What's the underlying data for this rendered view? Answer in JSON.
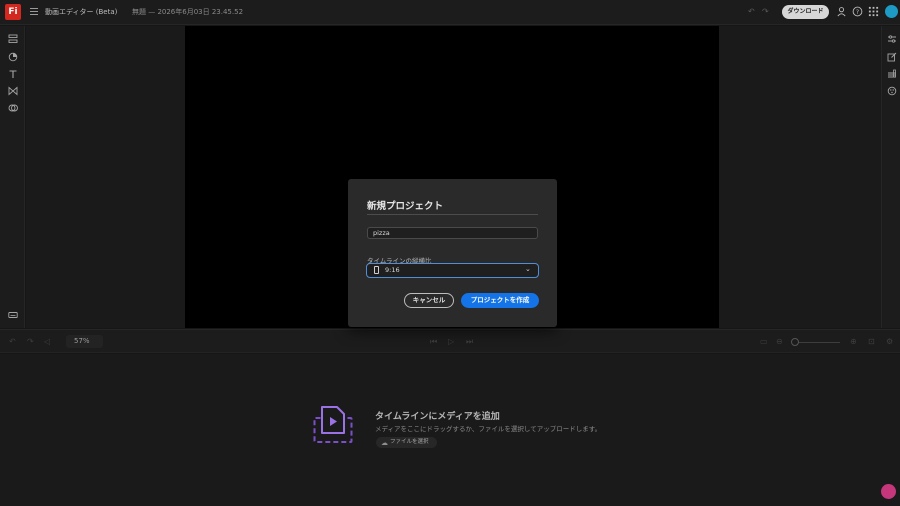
{
  "app": {
    "logo_text": "Fi",
    "title": "動画エディター (Beta)",
    "document_title": "無題 — 2026年6月03日 23.45.52",
    "download_label": "ダウンロード"
  },
  "left_tools": [
    "layers-icon",
    "shapes-icon",
    "text-icon",
    "transitions-icon",
    "media-icon"
  ],
  "right_tools": [
    "adjust-icon",
    "edit-icon",
    "audio-icon",
    "color-icon"
  ],
  "timeline": {
    "zoom": "57%",
    "empty_title": "タイムラインにメディアを追加",
    "empty_subtitle": "メディアをここにドラッグするか、ファイルを選択してアップロードします。",
    "file_button": "ファイルを選択"
  },
  "dialog": {
    "title": "新規プロジェクト",
    "project_name": "pizza",
    "ratio_label": "タイムラインの縦横比",
    "ratio_value": "9:16",
    "cancel_label": "キャンセル",
    "create_label": "プロジェクトを作成"
  },
  "colors": {
    "primary": "#1473e6",
    "select_focus": "#4f8fd8",
    "logo": "#d2281f",
    "avatar": "#1d9bc5",
    "help": "#c5367b"
  }
}
